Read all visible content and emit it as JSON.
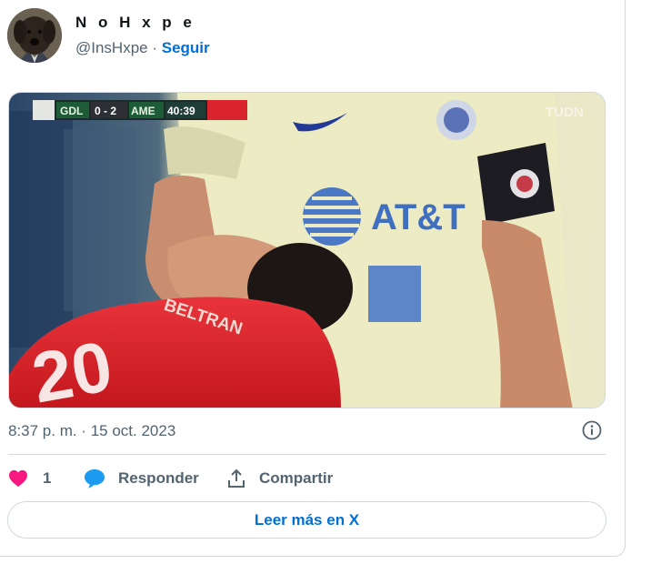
{
  "author": {
    "display_name": "N o H x p e",
    "handle": "@InsHxpe",
    "separator": " · ",
    "follow_label": "Seguir",
    "avatar_icon": "dog-avatar"
  },
  "media": {
    "scoreboard": {
      "home": "GDL",
      "score": "0 - 2",
      "away": "AME",
      "clock": "40:39"
    },
    "sponsor_text": "AT&T",
    "jersey_number": "20",
    "jersey_name": "BELTRAN",
    "broadcaster": "TUDN"
  },
  "timestamp": "8:37 p. m. · 15 oct. 2023",
  "actions": {
    "like_count": "1",
    "reply_label": "Responder",
    "share_label": "Compartir"
  },
  "read_more_label": "Leer más en X",
  "colors": {
    "accent": "#006fd6",
    "like": "#f91880",
    "reply": "#1d9bf0",
    "muted": "#536471",
    "border": "#cfd9de"
  }
}
